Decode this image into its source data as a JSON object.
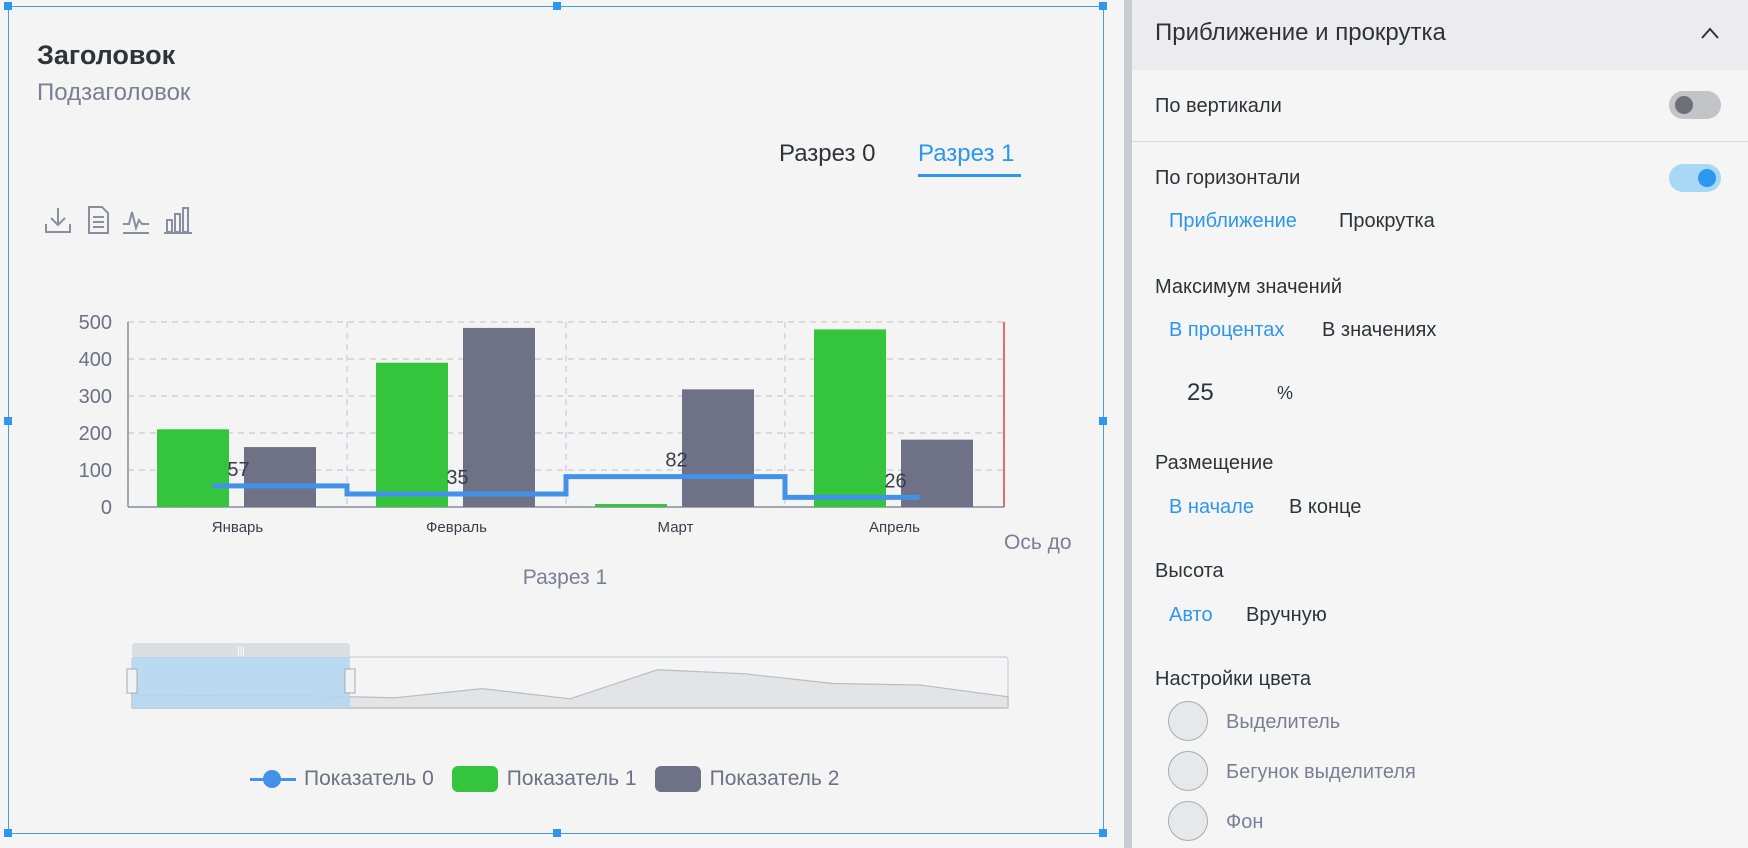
{
  "widget": {
    "title": "Заголовок",
    "subtitle": "Подзаголовок",
    "tabs": [
      "Разрез 0",
      "Разрез 1"
    ],
    "active_tab": 1,
    "tools": [
      "download-icon",
      "document-icon",
      "line-chart-icon",
      "bar-chart-icon"
    ]
  },
  "chart_data": {
    "type": "bar",
    "categories": [
      "Январь",
      "Февраль",
      "Март",
      "Апрель"
    ],
    "ylim": [
      0,
      500
    ],
    "yticks": [
      0,
      100,
      200,
      300,
      400,
      500
    ],
    "xlabel": "Разрез 1",
    "right_axis_label": "Ось до",
    "grid": true,
    "series": [
      {
        "name": "Показатель 0",
        "kind": "step-line",
        "values": [
          57,
          35,
          82,
          26
        ],
        "labels": [
          "57",
          "35",
          "82",
          "26"
        ],
        "color": "#4192e8"
      },
      {
        "name": "Показатель 1",
        "kind": "bar",
        "values": [
          210,
          390,
          8,
          480
        ],
        "color": "#34c53c"
      },
      {
        "name": "Показатель 2",
        "kind": "bar",
        "values": [
          162,
          484,
          318,
          182
        ],
        "color": "#6f7287"
      }
    ],
    "navigator": {
      "range_start": 0,
      "range_end": 0.25,
      "selection_color": "#b5d6f1",
      "area_color": "#e3e4e6"
    },
    "legend_position": "bottom"
  },
  "panel": {
    "title": "Приближение и прокрутка",
    "vertical_label": "По вертикали",
    "vertical_on": false,
    "horizontal_label": "По горизонтали",
    "horizontal_on": true,
    "horizontal_opts": [
      "Приближение",
      "Прокрутка"
    ],
    "max_label": "Максимум значений",
    "max_opts": [
      "В процентах",
      "В значениях"
    ],
    "max_value": "25",
    "max_unit": "%",
    "placement_label": "Размещение",
    "placement_opts": [
      "В начале",
      "В конце"
    ],
    "height_label": "Высота",
    "height_opts": [
      "Авто",
      "Вручную"
    ],
    "colors_label": "Настройки цвета",
    "colors": [
      "Выделитель",
      "Бегунок выделителя",
      "Фон"
    ]
  },
  "colors": {
    "accent": "#2d96ee",
    "series0": "#4192e8",
    "series1": "#34c53c",
    "series2": "#6f7287"
  }
}
